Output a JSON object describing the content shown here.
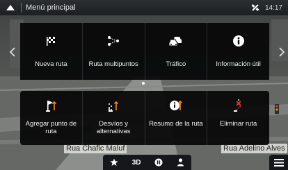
{
  "header": {
    "title": "Menú principal",
    "time": "14:17",
    "icons": {
      "back": "up-arrow-icon",
      "gps": "satellite-icon"
    }
  },
  "main_menu": {
    "items": [
      {
        "label": "Nueva ruta",
        "icon": "checkered-flag-icon"
      },
      {
        "label": "Ruta multipuntos",
        "icon": "multipoint-route-icon"
      },
      {
        "label": "Tráfico",
        "icon": "traffic-cars-icon"
      },
      {
        "label": "Información útil",
        "icon": "info-icon"
      }
    ],
    "page_count": 2,
    "current_page": 1
  },
  "route_menu": {
    "items": [
      {
        "label": "Agregar punto de ruta",
        "icon": "add-waypoint-icon"
      },
      {
        "label": "Desvíos y alternativas",
        "icon": "detours-icon"
      },
      {
        "label": "Resumo de la ruta",
        "icon": "route-summary-icon"
      },
      {
        "label": "Eliminar ruta",
        "icon": "delete-route-icon"
      }
    ]
  },
  "map": {
    "streets": [
      "Rua Chafic Maluf",
      "Rua Adelino Alves"
    ]
  },
  "bottom_bar": {
    "view_mode": "3D",
    "icons": [
      "star-icon",
      "pause-icon",
      "person-icon"
    ]
  },
  "colors": {
    "accent": "#f08a24",
    "alert": "#e53935",
    "panel": "#060608"
  }
}
